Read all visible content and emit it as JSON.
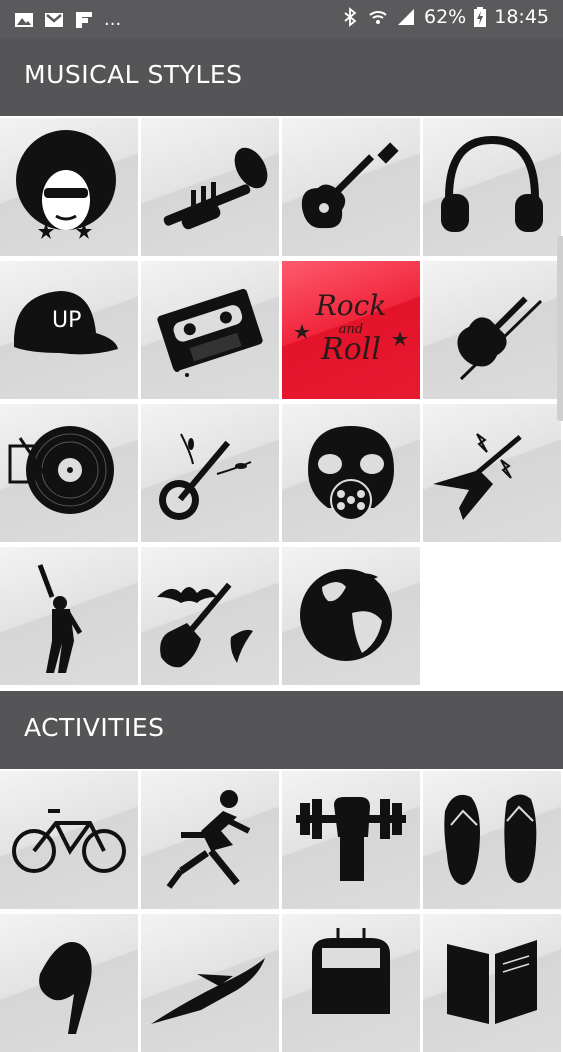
{
  "status_bar": {
    "battery": "62%",
    "time": "18:45",
    "overflow": "...",
    "left_icons": [
      "gallery-icon",
      "gmail-icon",
      "flipboard-icon"
    ],
    "right_icons": [
      "bluetooth-icon",
      "wifi-icon",
      "signal-icon",
      "battery-icon"
    ]
  },
  "sections": [
    {
      "title": "MUSICAL STYLES",
      "tiles": [
        {
          "icon": "afro-woman-icon"
        },
        {
          "icon": "trumpet-icon"
        },
        {
          "icon": "electric-guitar-icon"
        },
        {
          "icon": "headphones-icon"
        },
        {
          "icon": "cap-up-icon",
          "text": "UP"
        },
        {
          "icon": "cassette-tape-icon"
        },
        {
          "icon": "rock-and-roll-icon",
          "text_top": "Rock",
          "text_mid": "and",
          "text_bottom": "Roll",
          "selected": true
        },
        {
          "icon": "violin-icon"
        },
        {
          "icon": "turntable-icon"
        },
        {
          "icon": "banjo-icon"
        },
        {
          "icon": "gas-mask-icon"
        },
        {
          "icon": "flying-v-guitar-icon"
        },
        {
          "icon": "disco-dancer-icon"
        },
        {
          "icon": "bat-guitar-icon"
        },
        {
          "icon": "globe-icon"
        }
      ]
    },
    {
      "title": "ACTIVITIES",
      "tiles": [
        {
          "icon": "bicycle-icon"
        },
        {
          "icon": "runner-icon"
        },
        {
          "icon": "dumbbell-fist-icon"
        },
        {
          "icon": "flip-flops-icon"
        },
        {
          "icon": "high-heel-icon"
        },
        {
          "icon": "airplane-icon"
        },
        {
          "icon": "train-icon"
        },
        {
          "icon": "book-icon"
        }
      ]
    }
  ],
  "colors": {
    "header": "#555557",
    "statusbar": "#5a5a5c",
    "selected": "#e81a30",
    "icon": "#111111"
  }
}
